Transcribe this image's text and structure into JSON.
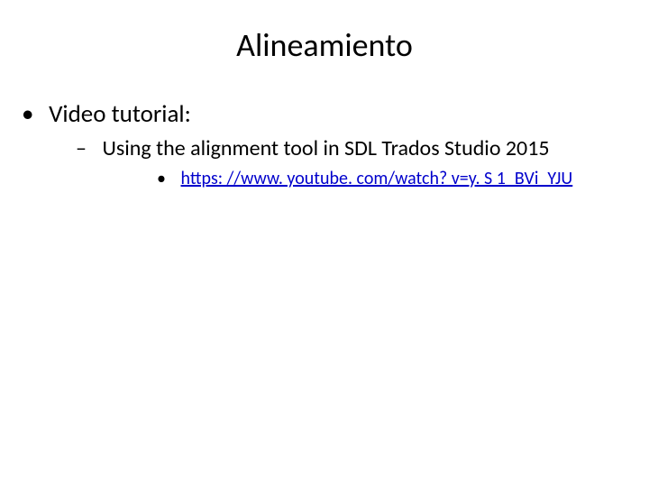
{
  "title": "Alineamiento",
  "bullets": {
    "lvl1": "Video tutorial:",
    "lvl2": "Using the alignment tool in SDL Trados Studio 2015",
    "lvl3_link_text": "https: //www. youtube. com/watch? v=y. S 1_BVi_YJU"
  }
}
